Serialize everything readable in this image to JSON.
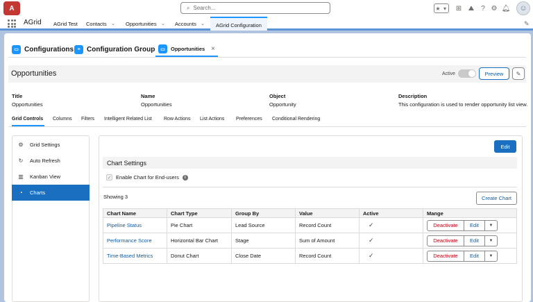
{
  "header": {
    "logo_text": "A",
    "search_placeholder": "Search...",
    "icons": [
      "star-icon",
      "chevron-down-icon",
      "add-icon",
      "trailhead-icon",
      "help-icon",
      "setup-gear-icon",
      "notification-bell-icon",
      "avatar-icon"
    ]
  },
  "nav": {
    "app_name": "AGrid",
    "items": [
      {
        "label": "AGrid Test",
        "has_menu": false
      },
      {
        "label": "Contacts",
        "has_menu": true
      },
      {
        "label": "Opportunities",
        "has_menu": true
      },
      {
        "label": "Accounts",
        "has_menu": true
      },
      {
        "label": "AGrid Configuration",
        "has_menu": false,
        "active": true
      }
    ]
  },
  "subtabs": {
    "configurations": "Configurations",
    "groups": "Configuration Groups",
    "active": "Opportunities",
    "close": "×"
  },
  "record": {
    "title": "Opportunities",
    "active_label": "Active",
    "preview_label": "Preview",
    "fields": [
      {
        "label": "Title",
        "value": "Opportunities"
      },
      {
        "label": "Name",
        "value": "Opportunities"
      },
      {
        "label": "Object",
        "value": "Opportunity"
      },
      {
        "label": "Description",
        "value": "This configuration is used to render opportunity list view."
      }
    ]
  },
  "detail_tabs": [
    "Grid Controls",
    "Columns",
    "Filters",
    "Intelligent Related List",
    "Row Actions",
    "List Actions",
    "Preferences",
    "Conditional Rendering"
  ],
  "side_nav": [
    {
      "label": "Grid Settings",
      "icon": "gear-icon"
    },
    {
      "label": "Auto Refresh",
      "icon": "refresh-icon"
    },
    {
      "label": "Kanban View",
      "icon": "kanban-icon"
    },
    {
      "label": "Charts",
      "icon": "pie-chart-icon",
      "active": true
    }
  ],
  "charts": {
    "edit_label": "Edit",
    "section_title": "Chart Settings",
    "enable_label": "Enable Chart for End-users",
    "enable_checked": true,
    "showing": "Showing 3",
    "create_label": "Create Chart",
    "columns": [
      "Chart Name",
      "Chart Type",
      "Group By",
      "Value",
      "Active",
      "Mange"
    ],
    "rows": [
      {
        "name": "Pipeline Status",
        "type": "Pie Chart",
        "group_by": "Lead Source",
        "value": "Record Count",
        "active": true
      },
      {
        "name": "Performance Score",
        "type": "Horizontal Bar Chart",
        "group_by": "Stage",
        "value": "Sum of Amount",
        "active": true
      },
      {
        "name": "Time-Based Metrics",
        "type": "Donut Chart",
        "group_by": "Close Date",
        "value": "Record Count",
        "active": true
      }
    ],
    "row_actions": {
      "deactivate": "Deactivate",
      "edit": "Edit"
    }
  },
  "colors": {
    "brand": "#1b96ff",
    "primary_button": "#1b6fc0",
    "link": "#0b5cab",
    "destructive": "#ba0517",
    "page_bg": "#b0c4df"
  }
}
